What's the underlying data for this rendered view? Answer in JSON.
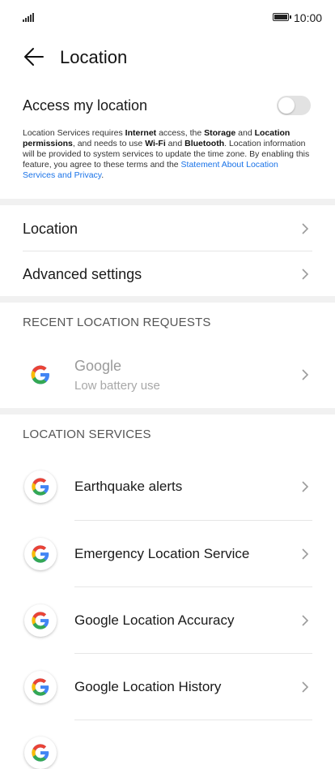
{
  "status_bar": {
    "time": "10:00"
  },
  "header": {
    "title": "Location"
  },
  "access": {
    "label": "Access my location",
    "toggle_on": false,
    "description": {
      "t1": "Location Services requires ",
      "b1": "Internet",
      "t2": " access, the ",
      "b2": "Storage",
      "t3": " and ",
      "b3": "Location permissions",
      "t4": ", and needs to use ",
      "b4": "Wi-Fi",
      "t5": " and ",
      "b5": "Bluetooth",
      "t6": ". Location information will be provided to system services to update the time zone. By enabling this feature, you agree to these terms and the ",
      "link": "Statement About Location Services and Privacy",
      "t7": "."
    }
  },
  "settings": [
    {
      "label": "Location"
    },
    {
      "label": "Advanced settings"
    }
  ],
  "recent_requests": {
    "header": "RECENT LOCATION REQUESTS",
    "items": [
      {
        "title": "Google",
        "subtitle": "Low battery use",
        "icon": "google-g-icon"
      }
    ]
  },
  "location_services": {
    "header": "LOCATION SERVICES",
    "items": [
      {
        "label": "Earthquake alerts",
        "icon": "google-g-icon"
      },
      {
        "label": "Emergency Location Service",
        "icon": "google-g-icon"
      },
      {
        "label": "Google Location Accuracy",
        "icon": "google-g-icon"
      },
      {
        "label": "Google Location History",
        "icon": "google-g-icon"
      }
    ]
  },
  "colors": {
    "link": "#1a73e8",
    "toggle_off": "#e2e2e2",
    "band": "#f1f1f1"
  }
}
